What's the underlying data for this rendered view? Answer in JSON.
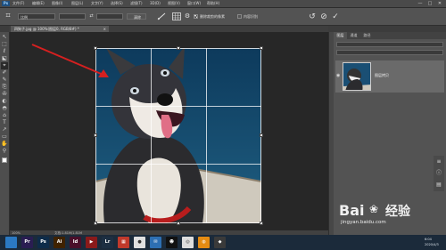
{
  "app": {
    "logo": "Ps",
    "menu": [
      "文件(F)",
      "编辑(E)",
      "图像(I)",
      "图层(L)",
      "文字(Y)",
      "选择(S)",
      "滤镜(T)",
      "3D(D)",
      "视图(V)",
      "窗口(W)",
      "帮助(H)"
    ],
    "window_buttons": [
      "—",
      "□",
      "✕"
    ]
  },
  "options": {
    "ratio_value": "比例",
    "swap_icon": "⇄",
    "clear_label": "清除",
    "straighten_icon": "straighten-icon",
    "delete_cropped_label": "删除裁剪的像素",
    "content_aware_label": "内容识别",
    "reset_icon": "↺",
    "cancel_icon": "⊘",
    "commit_icon": "✓"
  },
  "document": {
    "tab_label": "四狗子.jpg @ 100%(图层0, RGB/8#) *",
    "tab_close": "×",
    "zoom": "100%",
    "doc_info": "文档:1.81M/1.81M"
  },
  "tools": [
    "↖",
    "⬚",
    "ℓ",
    "⬕",
    "⌖",
    "✐",
    "✎",
    "⎘",
    "✇",
    "◐",
    "◓",
    "⌂",
    "T",
    "↗",
    "▭",
    "✋",
    "⚲"
  ],
  "panel": {
    "tabs": [
      "图层",
      "通道",
      "路径"
    ],
    "layer_name": "图层拷贝",
    "eye_icon": "◉"
  },
  "taskbar": {
    "apps": [
      {
        "icon": "",
        "color": "#2b79c2"
      },
      {
        "icon": "Pr",
        "color": "#2a1d52"
      },
      {
        "icon": "Ps",
        "color": "#0e2c4a"
      },
      {
        "icon": "Ai",
        "color": "#3f2200"
      },
      {
        "icon": "Id",
        "color": "#4a0f2a"
      },
      {
        "icon": "▶",
        "color": "#8a1a1a"
      },
      {
        "icon": "Lr",
        "color": "#1d2f42"
      },
      {
        "icon": "▦",
        "color": "#c0392b"
      },
      {
        "icon": "●",
        "color": "#e0e0e0"
      },
      {
        "icon": "✉",
        "color": "#2d6fb3"
      },
      {
        "icon": "☻",
        "color": "#111111"
      },
      {
        "icon": "◎",
        "color": "#dddddd"
      },
      {
        "icon": "◍",
        "color": "#e58b12"
      },
      {
        "icon": "◆",
        "color": "#3a3a3a"
      }
    ],
    "time": "6:04",
    "date": "2020/4/3"
  },
  "watermark": {
    "brand_prefix": "Bai",
    "brand_suffix": "经验",
    "url": "jingyan.baidu.com"
  },
  "colors": {
    "fg_swatch": "#ffffff",
    "bg_swatch": "#e02020",
    "arrow": "#d62020"
  }
}
